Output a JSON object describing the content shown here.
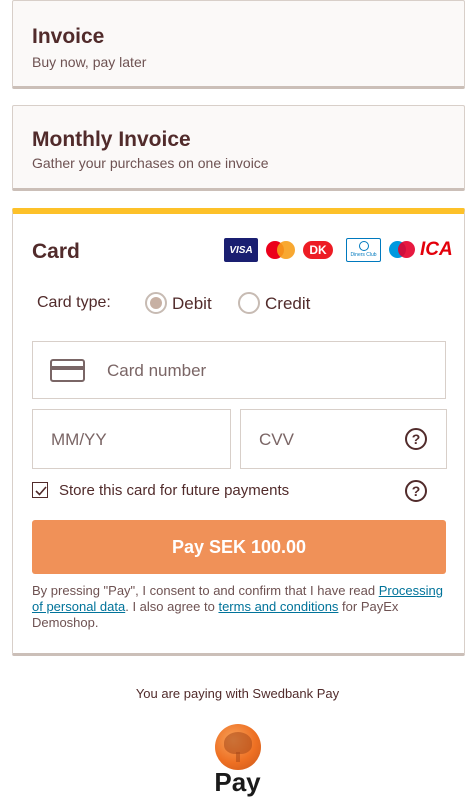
{
  "invoice": {
    "title": "Invoice",
    "subtitle": "Buy now, pay later"
  },
  "monthly_invoice": {
    "title": "Monthly Invoice",
    "subtitle": "Gather your purchases on one invoice"
  },
  "card": {
    "title": "Card",
    "logos": {
      "visa": "VISA",
      "mastercard_icon": "mastercard-icon",
      "dankort": "DK",
      "diners": "Diners Club",
      "maestro_icon": "maestro-icon",
      "ica": "ICA"
    },
    "card_type_label": "Card type:",
    "card_type_options": [
      "Debit",
      "Credit"
    ],
    "card_type_selected": "Debit",
    "card_number_placeholder": "Card number",
    "expiry_placeholder": "MM/YY",
    "cvv_placeholder": "CVV",
    "help_symbol": "?",
    "store_card_label": "Store this card for future payments",
    "store_card_checked": true,
    "pay_button_label": "Pay SEK 100.00",
    "consent": {
      "text_1": "By pressing \"Pay\", I consent to and confirm that I have read ",
      "link_1": "Processing of personal data",
      "text_2": ". I also agree to ",
      "link_2": "terms and conditions",
      "text_3": " for PayEx Demoshop."
    }
  },
  "footer": {
    "paying_with": "You are paying with Swedbank Pay",
    "brand_word": "Pay",
    "logo_icon": "swedbank-oak-icon"
  },
  "colors": {
    "brand_text": "#512b2b",
    "accent_bar": "#fdc129",
    "pay_button": "#f09158",
    "link": "#00739a"
  }
}
